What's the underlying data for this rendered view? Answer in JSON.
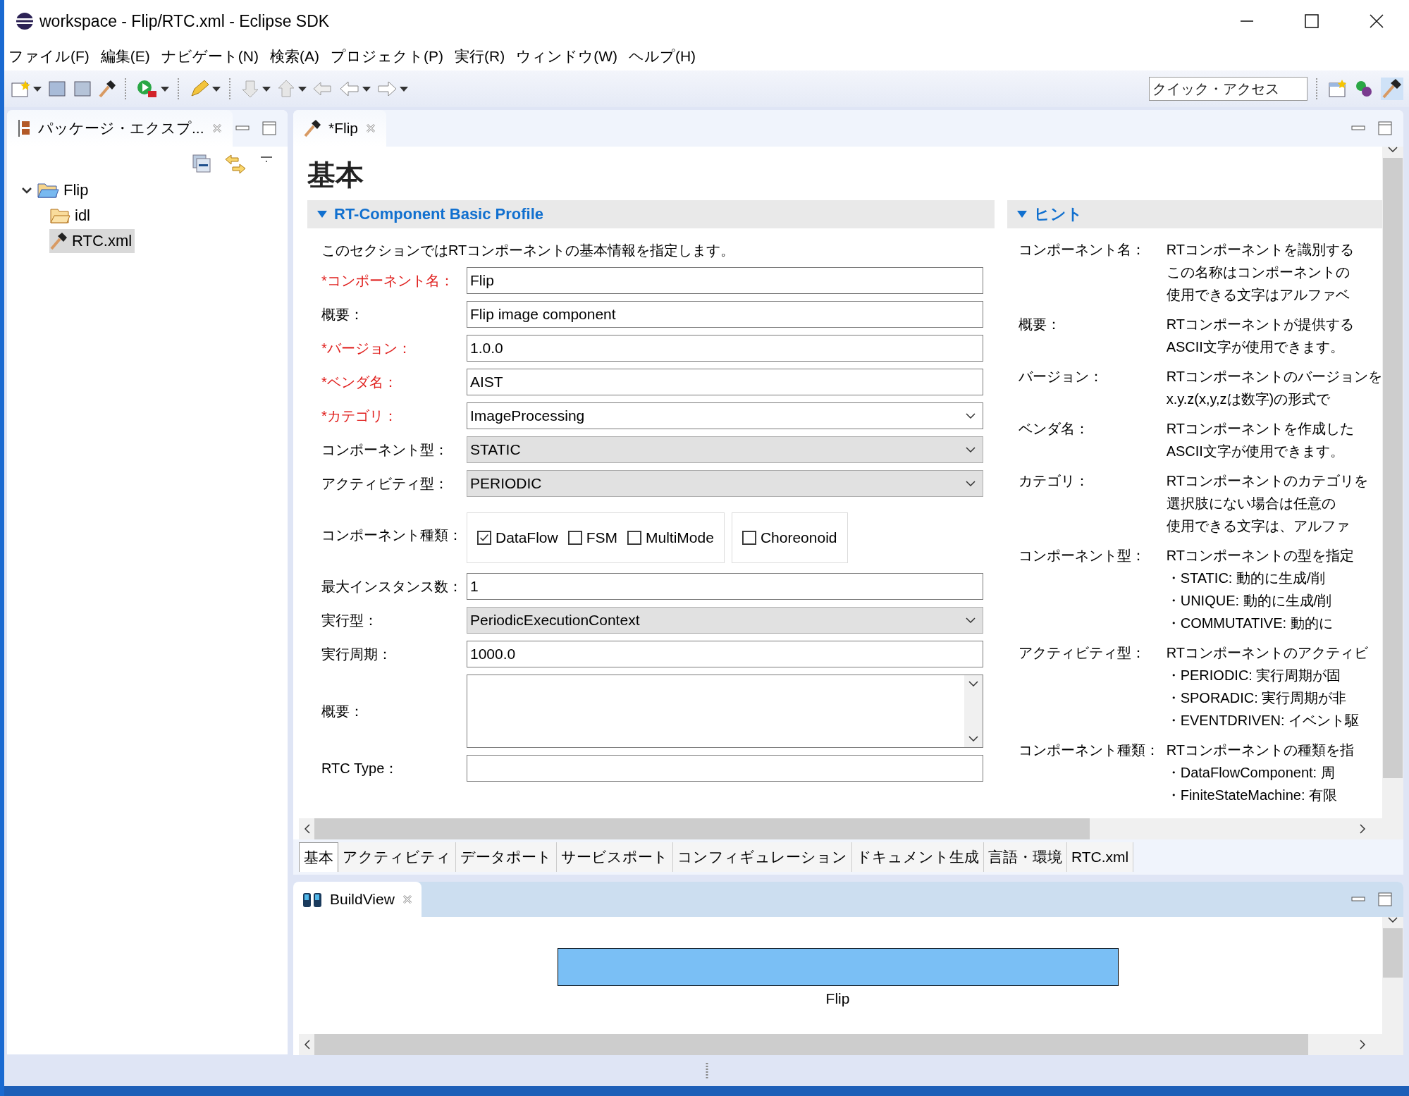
{
  "window": {
    "title": "workspace - Flip/RTC.xml - Eclipse SDK"
  },
  "menu": [
    "ファイル(F)",
    "編集(E)",
    "ナビゲート(N)",
    "検索(A)",
    "プロジェクト(P)",
    "実行(R)",
    "ウィンドウ(W)",
    "ヘルプ(H)"
  ],
  "quick_access": {
    "placeholder": "クイック・アクセス"
  },
  "package_explorer": {
    "tab": "パッケージ・エクスプ...",
    "tree": [
      {
        "label": "Flip",
        "kind": "project",
        "expanded": true,
        "selected": false,
        "children": [
          {
            "label": "idl",
            "kind": "folder",
            "selected": false
          },
          {
            "label": "RTC.xml",
            "kind": "file",
            "selected": true
          }
        ]
      }
    ]
  },
  "editor": {
    "tab": "*Flip",
    "heading": "基本",
    "section": {
      "title": "RT-Component Basic Profile",
      "expanded": true,
      "description": "このセクションではRTコンポーネントの基本情報を指定します。",
      "fields": [
        {
          "label": "*コンポーネント名：",
          "required": true,
          "kind": "text",
          "value": "Flip"
        },
        {
          "label": "概要：",
          "required": false,
          "kind": "text",
          "value": "Flip image component"
        },
        {
          "label": "*バージョン：",
          "required": true,
          "kind": "text",
          "value": "1.0.0"
        },
        {
          "label": "*ベンダ名：",
          "required": true,
          "kind": "text",
          "value": "AIST"
        },
        {
          "label": "*カテゴリ：",
          "required": true,
          "kind": "combo",
          "value": "ImageProcessing"
        },
        {
          "label": "コンポーネント型：",
          "required": false,
          "kind": "select",
          "value": "STATIC"
        },
        {
          "label": "アクティビティ型：",
          "required": false,
          "kind": "select",
          "value": "PERIODIC"
        },
        {
          "label": "コンポーネント種類：",
          "required": false,
          "kind": "checks",
          "groups": [
            {
              "options": [
                {
                  "label": "DataFlow",
                  "checked": true
                },
                {
                  "label": "FSM",
                  "checked": false
                },
                {
                  "label": "MultiMode",
                  "checked": false
                }
              ]
            },
            {
              "options": [
                {
                  "label": "Choreonoid",
                  "checked": false
                }
              ]
            }
          ]
        },
        {
          "label": "最大インスタンス数：",
          "required": false,
          "kind": "text",
          "value": "1"
        },
        {
          "label": "実行型：",
          "required": false,
          "kind": "select",
          "value": "PeriodicExecutionContext"
        },
        {
          "label": "実行周期：",
          "required": false,
          "kind": "text",
          "value": "1000.0"
        },
        {
          "label": "概要：",
          "required": false,
          "kind": "textarea"
        },
        {
          "label": "RTC Type：",
          "required": false,
          "kind": "text"
        }
      ]
    },
    "hints": {
      "title": "ヒント",
      "expanded": true,
      "items": [
        {
          "label": "コンポーネント名：",
          "lines": [
            "RTコンポーネントを識別する",
            "この名称はコンポーネントの",
            "使用できる文字はアルファベ"
          ]
        },
        {
          "label": "概要：",
          "lines": [
            "RTコンポーネントが提供する",
            "ASCII文字が使用できます。"
          ]
        },
        {
          "label": "バージョン：",
          "lines": [
            "RTコンポーネントのバージョンを",
            "x.y.z(x,y,zは数字)の形式で"
          ]
        },
        {
          "label": "ベンダ名：",
          "lines": [
            "RTコンポーネントを作成した",
            "ASCII文字が使用できます。"
          ]
        },
        {
          "label": "カテゴリ：",
          "lines": [
            "RTコンポーネントのカテゴリを",
            "選択肢にない場合は任意の",
            "使用できる文字は、アルファ"
          ]
        },
        {
          "label": "コンポーネント型：",
          "lines": [
            "RTコンポーネントの型を指定",
            "・STATIC: 動的に生成/削",
            "・UNIQUE: 動的に生成/削",
            "・COMMUTATIVE: 動的に"
          ]
        },
        {
          "label": "アクティビティ型：",
          "lines": [
            "RTコンポーネントのアクティビ",
            "・PERIODIC: 実行周期が固",
            "・SPORADIC: 実行周期が非",
            "・EVENTDRIVEN: イベント駆"
          ]
        },
        {
          "label": "コンポーネント種類：",
          "lines": [
            "RTコンポーネントの種類を指",
            "・DataFlowComponent: 周",
            "・FiniteStateMachine: 有限"
          ]
        }
      ]
    },
    "page_tabs": [
      {
        "label": "基本",
        "selected": true
      },
      {
        "label": "アクティビティ",
        "selected": false
      },
      {
        "label": "データポート",
        "selected": false
      },
      {
        "label": "サービスポート",
        "selected": false
      },
      {
        "label": "コンフィギュレーション",
        "selected": false
      },
      {
        "label": "ドキュメント生成",
        "selected": false
      },
      {
        "label": "言語・環境",
        "selected": false
      },
      {
        "label": "RTC.xml",
        "selected": false
      }
    ]
  },
  "build_view": {
    "tab": "BuildView",
    "component": {
      "label": "Flip"
    }
  }
}
